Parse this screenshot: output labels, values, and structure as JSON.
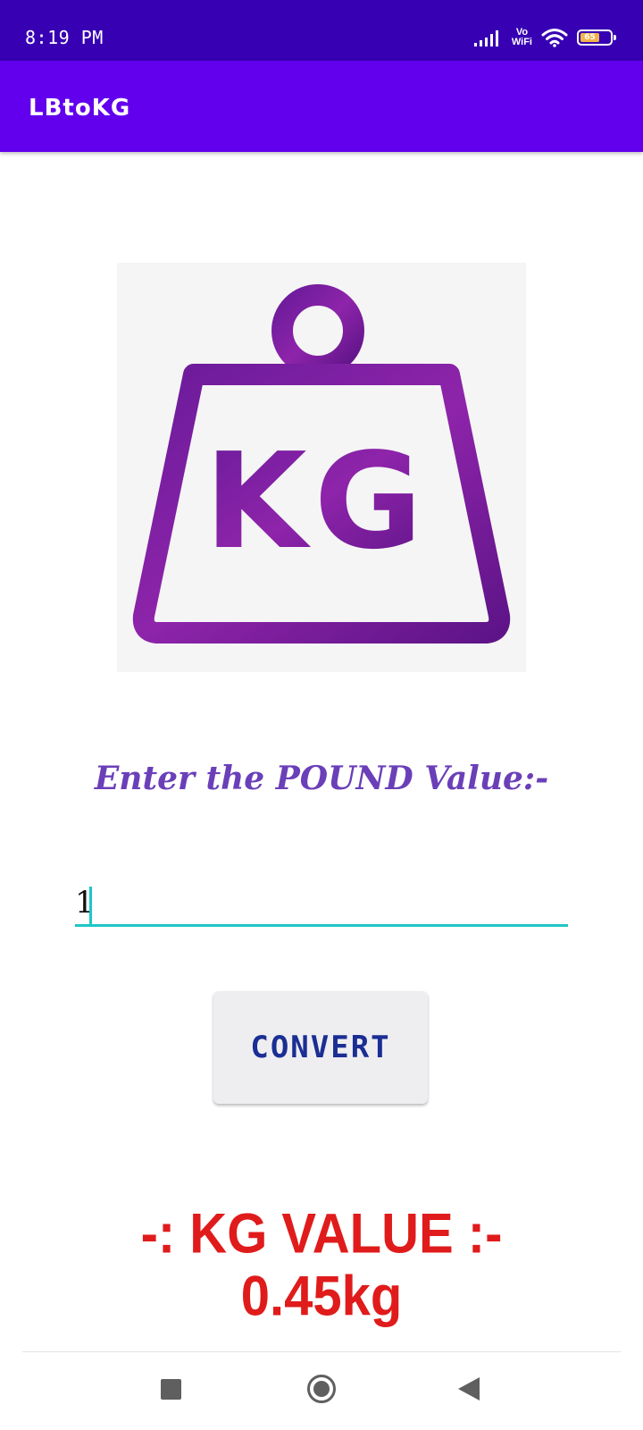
{
  "status_bar": {
    "time": "8:19 PM",
    "volte_top": "Vo",
    "volte_bottom": "WiFi",
    "battery_level": "65",
    "icons": [
      "signal-icon",
      "volte-wifi-icon",
      "wifi-icon",
      "battery-icon"
    ]
  },
  "app_bar": {
    "title": "LBtoKG",
    "color": "#6200ee",
    "status_color": "#3700b3"
  },
  "hero": {
    "icon": "weight-kg-icon",
    "weight_label": "KG",
    "color": "#7b1fa2"
  },
  "form": {
    "prompt": "Enter the POUND Value:-",
    "input_value": "1",
    "underline_color": "#1ec6c6",
    "convert_label": "CONVERT"
  },
  "result": {
    "title": "-: KG VALUE :-",
    "value": "0.45kg",
    "color": "#e01b1b"
  },
  "nav_bar": {
    "icons": [
      "recents-icon",
      "home-icon",
      "back-icon"
    ]
  }
}
